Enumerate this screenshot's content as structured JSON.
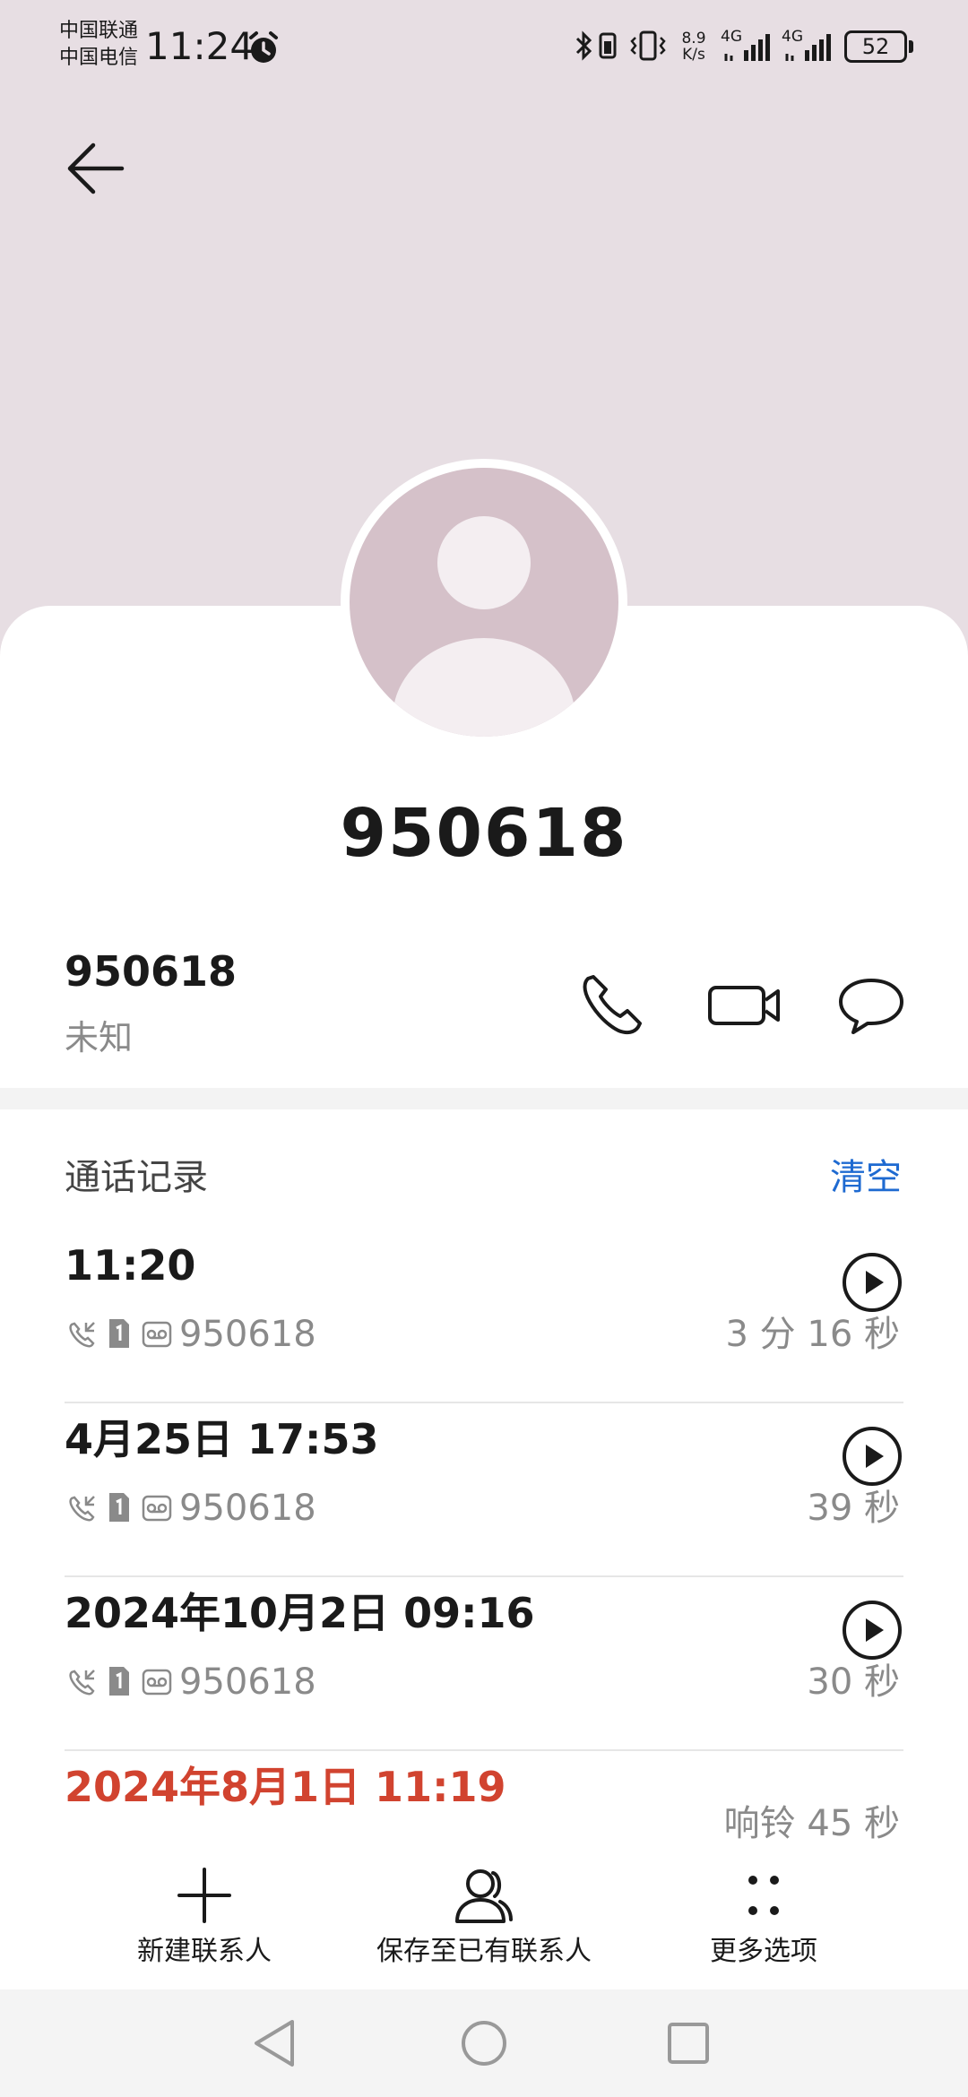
{
  "status_bar": {
    "carrier_1": "中国联通",
    "carrier_2": "中国电信",
    "time": "11:24",
    "net_speed_value": "8.9",
    "net_speed_unit": "K/s",
    "signal_1": "4G",
    "signal_2": "4G",
    "battery": "52"
  },
  "header": {
    "title": "950618"
  },
  "contact": {
    "number": "950618",
    "label": "未知"
  },
  "call_log": {
    "title": "通话记录",
    "clear_label": "清空",
    "entries": [
      {
        "time": "11:20",
        "number": "950618",
        "duration": "3 分 16 秒",
        "missed": false
      },
      {
        "time": "4月25日 17:53",
        "number": "950618",
        "duration": "39 秒",
        "missed": false
      },
      {
        "time": "2024年10月2日 09:16",
        "number": "950618",
        "duration": "30 秒",
        "missed": false
      },
      {
        "time": "2024年8月1日 11:19",
        "number": "",
        "duration": "响铃 45 秒",
        "missed": true
      }
    ]
  },
  "toolbar": {
    "new_contact": "新建联系人",
    "save_to_existing": "保存至已有联系人",
    "more_options": "更多选项"
  },
  "colors": {
    "header_bg": "#e7dee3",
    "accent_blue": "#1e6ad1",
    "missed_red": "#d1432f",
    "secondary_text": "#8a8a8a"
  }
}
